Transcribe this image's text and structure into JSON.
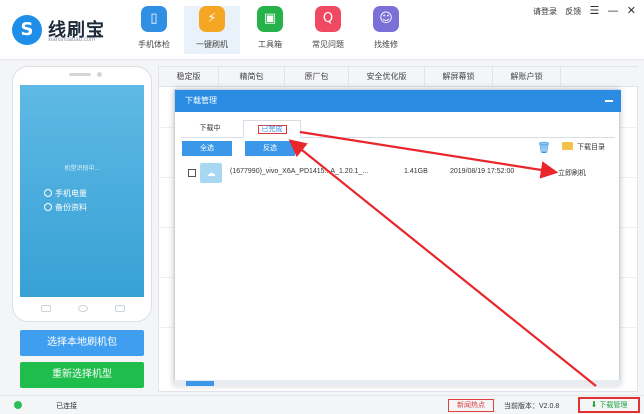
{
  "app": {
    "name": "线刷宝",
    "url": "xianshuabao.com"
  },
  "window_controls": {
    "login": "请登录",
    "feedback": "反馈",
    "menu_icon": "menu-icon",
    "minimize_icon": "minimize-icon",
    "close_icon": "close-icon"
  },
  "nav": {
    "items": [
      {
        "label": "手机体检",
        "icon": "phone-check-icon",
        "color": "#2f8fe3"
      },
      {
        "label": "一键刷机",
        "icon": "flash-icon",
        "color": "#f5a623"
      },
      {
        "label": "工具箱",
        "icon": "toolbox-icon",
        "color": "#27b14a"
      },
      {
        "label": "常见问题",
        "icon": "question-icon",
        "color": "#ef4a62"
      },
      {
        "label": "找维修",
        "icon": "repair-icon",
        "color": "#7b6fd8"
      }
    ]
  },
  "phone": {
    "status": "机型识别中...",
    "battery_label": "手机电量",
    "backup_label": "备份资料"
  },
  "left_buttons": {
    "select_local": "选择本地刷机包",
    "reselect_model": "重新选择机型"
  },
  "firmware_tabs": [
    "稳定版",
    "精简包",
    "原厂包",
    "安全优化版",
    "解屏幕锁",
    "解账户锁"
  ],
  "dialog": {
    "title": "下载管理",
    "tabs": [
      "下载中",
      "已完成"
    ],
    "select_all": "全选",
    "invert": "反选",
    "download_dir": "下载目录",
    "files": [
      {
        "name": "(1677990)_vivo_X6A_PD1415...A_1.20.1_...",
        "size": "1.41GB",
        "date": "2019/08/19 17:52:00",
        "action": "立即刷机"
      }
    ]
  },
  "statusbar": {
    "connection": "已连接",
    "hot_news": "新闻热点",
    "version": "当前版本：V2.0.8",
    "download_manager": "下载管理"
  }
}
